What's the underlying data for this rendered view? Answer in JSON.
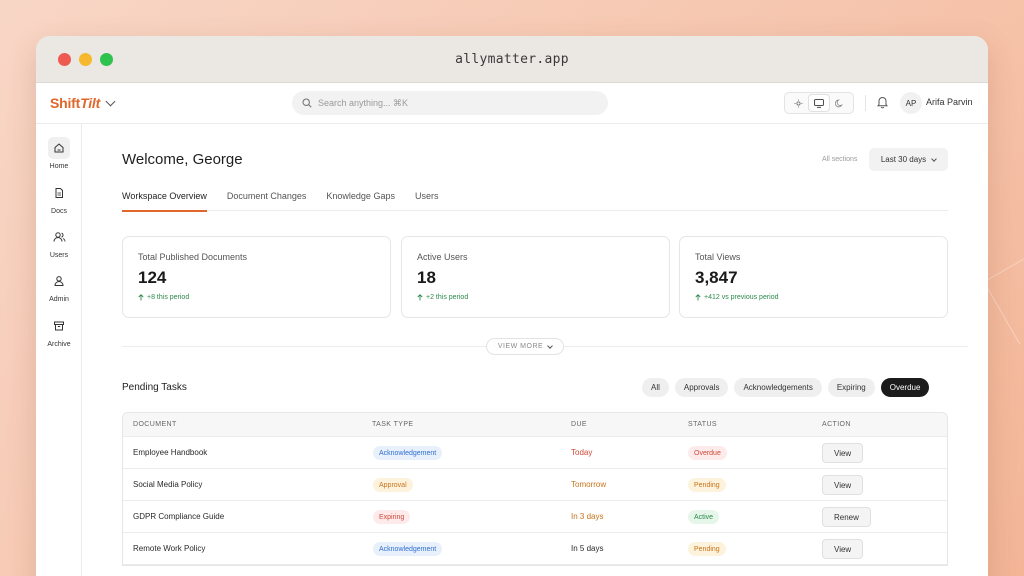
{
  "window": {
    "url": "allymatter.app"
  },
  "topbar": {
    "brand_plain": "Shift",
    "brand_italic": "Tilt",
    "search_placeholder": "Search anything... ⌘K",
    "user_initials": "AP",
    "user_name": "Arifa Parvin"
  },
  "sidebar": {
    "items": [
      {
        "label": "Home",
        "icon": "home-icon"
      },
      {
        "label": "Docs",
        "icon": "document-icon"
      },
      {
        "label": "Users",
        "icon": "users-icon"
      },
      {
        "label": "Admin",
        "icon": "admin-icon"
      },
      {
        "label": "Archive",
        "icon": "archive-icon"
      }
    ]
  },
  "header": {
    "welcome": "Welcome, George",
    "sections_label": "All sections",
    "date_range": "Last 30 days"
  },
  "tabs": [
    "Workspace Overview",
    "Document Changes",
    "Knowledge Gaps",
    "Users"
  ],
  "stats": [
    {
      "label": "Total Published Documents",
      "value": "124",
      "delta": "+8 this period"
    },
    {
      "label": "Active Users",
      "value": "18",
      "delta": "+2 this period"
    },
    {
      "label": "Total Views",
      "value": "3,847",
      "delta": "+412 vs previous period"
    }
  ],
  "view_more": "VIEW MORE",
  "pending": {
    "title": "Pending Tasks",
    "filters": [
      "All",
      "Approvals",
      "Acknowledgements",
      "Expiring",
      "Overdue"
    ],
    "active_filter": "Overdue",
    "columns": [
      "DOCUMENT",
      "TASK TYPE",
      "DUE",
      "STATUS",
      "ACTION"
    ],
    "rows": [
      {
        "document": "Employee Handbook",
        "task_type": "Acknowledgement",
        "due": "Today",
        "status": "Overdue",
        "action": "View"
      },
      {
        "document": "Social Media Policy",
        "task_type": "Approval",
        "due": "Tomorrow",
        "status": "Pending",
        "action": "View"
      },
      {
        "document": "GDPR Compliance Guide",
        "task_type": "Expiring",
        "due": "In 3 days",
        "status": "Active",
        "action": "Renew"
      },
      {
        "document": "Remote Work Policy",
        "task_type": "Acknowledgement",
        "due": "In 5 days",
        "status": "Pending",
        "action": "View"
      }
    ]
  },
  "colors": {
    "accent": "#e0662a",
    "positive": "#2a8a4a",
    "danger": "#d04a3a",
    "warning": "#c8741a"
  }
}
